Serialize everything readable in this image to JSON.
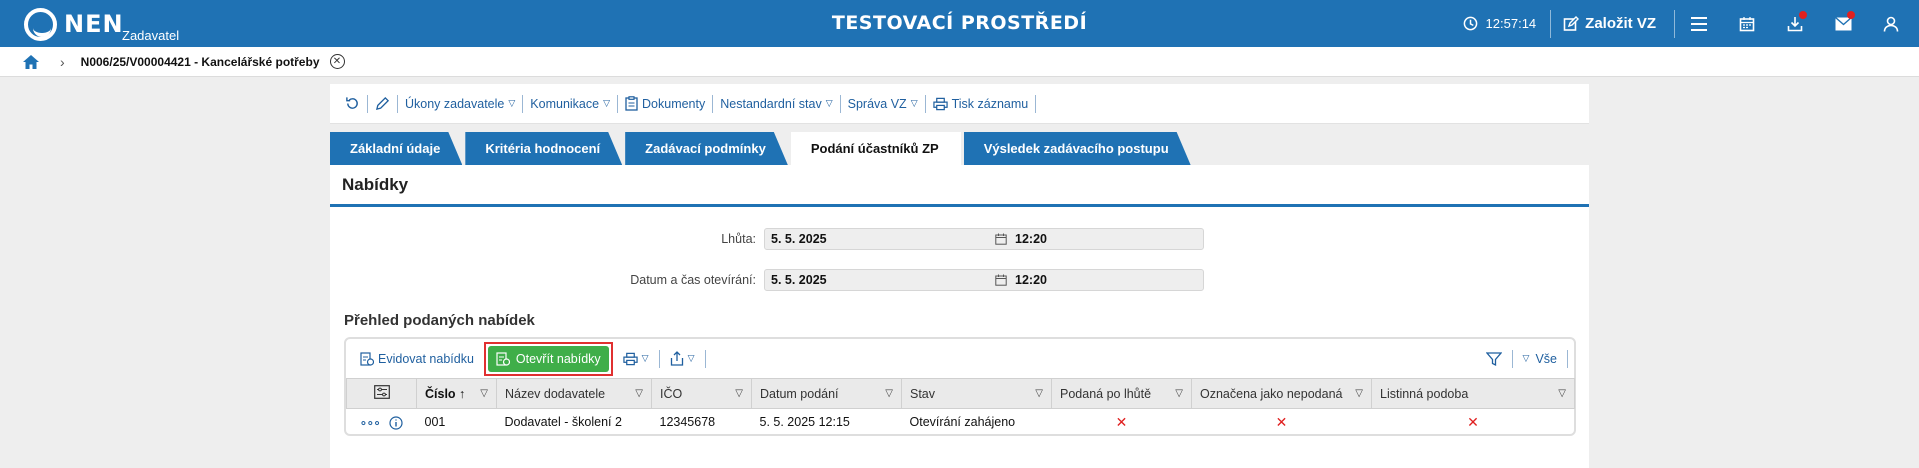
{
  "app": {
    "logo_text": "NEN",
    "logo_sub": "Zadavatel",
    "environment": "TESTOVACÍ PROSTŘEDÍ",
    "clock": "12:57:14",
    "create_label": "Založit VZ"
  },
  "breadcrumb": {
    "current": "N006/25/V00004421 - Kancelářské potřeby"
  },
  "toolbar": {
    "ukony": "Úkony zadavatele",
    "komunikace": "Komunikace",
    "dokumenty": "Dokumenty",
    "nestandardni": "Nestandardní stav",
    "sprava": "Správa VZ",
    "tisk": "Tisk záznamu"
  },
  "tabs": [
    {
      "label": "Základní údaje"
    },
    {
      "label": "Kritéria hodnocení"
    },
    {
      "label": "Zadávací podmínky"
    },
    {
      "label": "Podání účastníků ZP"
    },
    {
      "label": "Výsledek zadávacího postupu"
    }
  ],
  "section": {
    "title": "Nabídky",
    "lhuta_label": "Lhůta:",
    "lhuta_date": "5. 5. 2025",
    "lhuta_time": "12:20",
    "otevirani_label": "Datum a čas otevírání:",
    "otevirani_date": "5. 5. 2025",
    "otevirani_time": "12:20"
  },
  "grid": {
    "title": "Přehled podaných nabídek",
    "evidovat": "Evidovat nabídku",
    "otevrit": "Otevřít nabídky",
    "vse": "Vše",
    "columns": [
      "Číslo",
      "Název dodavatele",
      "IČO",
      "Datum podání",
      "Stav",
      "Podaná po lhůtě",
      "Označena jako nepodaná",
      "Listinná podoba"
    ],
    "rows": [
      {
        "cislo": "001",
        "nazev": "Dodavatel - školení 2",
        "ico": "12345678",
        "datum": "5. 5. 2025 12:15",
        "stav": "Otevírání zahájeno",
        "po_lhute": "✕",
        "nepodana": "✕",
        "listinna": "✕"
      }
    ]
  }
}
